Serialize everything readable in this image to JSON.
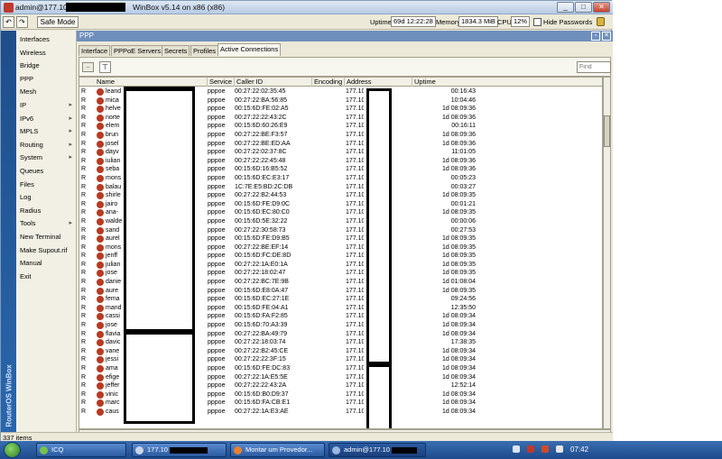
{
  "window": {
    "title_prefix": "admin@177.10",
    "title_suffix": "WinBox v5.14 on x86 (x86)",
    "min_label": "_",
    "max_label": "□",
    "close_label": "✕"
  },
  "toolbar": {
    "undo_label": "↶",
    "redo_label": "↷",
    "safe_mode_label": "Safe Mode",
    "uptime_label": "Uptime",
    "uptime_value": "69d 12:22:28",
    "memory_label": "Memory",
    "memory_value": "1834.3 MiB",
    "cpu_label": "CPU",
    "cpu_value": "12%",
    "hide_passwords_label": "Hide Passwords"
  },
  "sidebar": {
    "brand": "RouterOS WinBox",
    "items": [
      {
        "label": "Interfaces",
        "arrow": ""
      },
      {
        "label": "Wireless",
        "arrow": ""
      },
      {
        "label": "Bridge",
        "arrow": ""
      },
      {
        "label": "PPP",
        "arrow": ""
      },
      {
        "label": "Mesh",
        "arrow": ""
      },
      {
        "label": "IP",
        "arrow": "▸"
      },
      {
        "label": "IPv6",
        "arrow": "▸"
      },
      {
        "label": "MPLS",
        "arrow": "▸"
      },
      {
        "label": "Routing",
        "arrow": "▸"
      },
      {
        "label": "System",
        "arrow": "▸"
      },
      {
        "label": "Queues",
        "arrow": ""
      },
      {
        "label": "Files",
        "arrow": ""
      },
      {
        "label": "Log",
        "arrow": ""
      },
      {
        "label": "Radius",
        "arrow": ""
      },
      {
        "label": "Tools",
        "arrow": "▸"
      },
      {
        "label": "New Terminal",
        "arrow": ""
      },
      {
        "label": "Make Supout.rif",
        "arrow": ""
      },
      {
        "label": "Manual",
        "arrow": ""
      },
      {
        "label": "Exit",
        "arrow": ""
      }
    ]
  },
  "ppp": {
    "title": "PPP",
    "tabs": [
      "Interface",
      "PPPoE Servers",
      "Secrets",
      "Profiles",
      "Active Connections"
    ],
    "active_tab": "Active Connections",
    "minus_label": "−",
    "filter_label": "⊤",
    "find_placeholder": "Find",
    "columns": [
      "Name",
      "Service",
      "Caller ID",
      "Encoding",
      "Address",
      "Uptime"
    ],
    "status": "337 items",
    "rows": [
      {
        "flag": "R",
        "name": "leand",
        "service": "pppoe",
        "caller": "00:27:22:02:35:45",
        "addr": "177.10",
        "uptime": "00:16:43"
      },
      {
        "flag": "R",
        "name": "mica",
        "service": "pppoe",
        "caller": "00:27:22:BA:56:85",
        "addr": "177.10",
        "uptime": "10:04:46"
      },
      {
        "flag": "R",
        "name": "helve",
        "service": "pppoe",
        "caller": "00:15:6D:FE:02:A5",
        "addr": "177.10",
        "uptime": "1d 08:09:36"
      },
      {
        "flag": "R",
        "name": "norte",
        "service": "pppoe",
        "caller": "00:27:22:22:43:2C",
        "addr": "177.10",
        "uptime": "1d 08:09:36"
      },
      {
        "flag": "R",
        "name": "elem",
        "service": "pppoe",
        "caller": "00:15:6D:60:26:E9",
        "addr": "177.10",
        "uptime": "00:16:11"
      },
      {
        "flag": "R",
        "name": "brun",
        "service": "pppoe",
        "caller": "00:27:22:BE:F3:57",
        "addr": "177.10",
        "uptime": "1d 08:09:36"
      },
      {
        "flag": "R",
        "name": "josel",
        "service": "pppoe",
        "caller": "00:27:22:BE:ED:AA",
        "addr": "177.10",
        "uptime": "1d 08:09:36"
      },
      {
        "flag": "R",
        "name": "dayv",
        "service": "pppoe",
        "caller": "00:27:22:02:37:8C",
        "addr": "177.10",
        "uptime": "11:01:05"
      },
      {
        "flag": "R",
        "name": "iulian",
        "service": "pppoe",
        "caller": "00:27:22:22:45:48",
        "addr": "177.10",
        "uptime": "1d 08:09:36"
      },
      {
        "flag": "R",
        "name": "seba",
        "service": "pppoe",
        "caller": "00:15:6D:16:B5:52",
        "addr": "177.10",
        "uptime": "1d 08:09:36"
      },
      {
        "flag": "R",
        "name": "mons",
        "service": "pppoe",
        "caller": "00:15:6D:EC:E3:17",
        "addr": "177.10",
        "uptime": "00:05:23"
      },
      {
        "flag": "R",
        "name": "balau",
        "service": "pppoe",
        "caller": "1C:7E:E5:BD:2C:DB",
        "addr": "177.10",
        "uptime": "00:03:27"
      },
      {
        "flag": "R",
        "name": "shirle",
        "service": "pppoe",
        "caller": "00:27:22:B2:44:53",
        "addr": "177.10",
        "uptime": "1d 08:09:35"
      },
      {
        "flag": "R",
        "name": "jairo",
        "service": "pppoe",
        "caller": "00:15:6D:FE:D9:0C",
        "addr": "177.10",
        "uptime": "00:01:21"
      },
      {
        "flag": "R",
        "name": "ana-",
        "service": "pppoe",
        "caller": "00:15:6D:EC:80:C0",
        "addr": "177.10",
        "uptime": "1d 08:09:35"
      },
      {
        "flag": "R",
        "name": "walde",
        "service": "pppoe",
        "caller": "00:15:6D:5E:32:22",
        "addr": "177.10",
        "uptime": "00:00:06"
      },
      {
        "flag": "R",
        "name": "sand",
        "service": "pppoe",
        "caller": "00:27:22:30:58:73",
        "addr": "177.10",
        "uptime": "00:27:53"
      },
      {
        "flag": "R",
        "name": "aurel",
        "service": "pppoe",
        "caller": "00:15:6D:FE:D9:B5",
        "addr": "177.10",
        "uptime": "1d 08:09:35"
      },
      {
        "flag": "R",
        "name": "mons",
        "service": "pppoe",
        "caller": "00:27:22:BE:EF:14",
        "addr": "177.10",
        "uptime": "1d 08:09:35"
      },
      {
        "flag": "R",
        "name": "jenff",
        "service": "pppoe",
        "caller": "00:15:6D:FC:DE:8D",
        "addr": "177.10",
        "uptime": "1d 08:09:35"
      },
      {
        "flag": "R",
        "name": "julian",
        "service": "pppoe",
        "caller": "00:27:22:1A:E0:1A",
        "addr": "177.10",
        "uptime": "1d 08:09:35"
      },
      {
        "flag": "R",
        "name": "jose",
        "service": "pppoe",
        "caller": "00:27:22:18:02:47",
        "addr": "177.10",
        "uptime": "1d 08:09:35"
      },
      {
        "flag": "R",
        "name": "danie",
        "service": "pppoe",
        "caller": "00:27:22:BC:7E:9B",
        "addr": "177.10",
        "uptime": "1d 01:08:04"
      },
      {
        "flag": "R",
        "name": "aure",
        "service": "pppoe",
        "caller": "00:15:6D:E8:0A:47",
        "addr": "177.10",
        "uptime": "1d 08:09:35"
      },
      {
        "flag": "R",
        "name": "fema",
        "service": "pppoe",
        "caller": "00:15:6D:EC:27:1E",
        "addr": "177.10",
        "uptime": "09:24:56"
      },
      {
        "flag": "R",
        "name": "mand",
        "service": "pppoe",
        "caller": "00:15:6D:FE:04:A1",
        "addr": "177.10",
        "uptime": "12:35:50"
      },
      {
        "flag": "R",
        "name": "cassi",
        "service": "pppoe",
        "caller": "00:15:6D:FA:F2:85",
        "addr": "177.10",
        "uptime": "1d 08:09:34"
      },
      {
        "flag": "R",
        "name": "jose",
        "service": "pppoe",
        "caller": "00:15:6D:70:A3:39",
        "addr": "177.10",
        "uptime": "1d 08:09:34"
      },
      {
        "flag": "R",
        "name": "flavia",
        "service": "pppoe",
        "caller": "00:27:22:BA:49:79",
        "addr": "177.10",
        "uptime": "1d 08:09:34"
      },
      {
        "flag": "R",
        "name": "davic",
        "service": "pppoe",
        "caller": "00:27:22:18:03:74",
        "addr": "177.10",
        "uptime": "17:38:35"
      },
      {
        "flag": "R",
        "name": "vane",
        "service": "pppoe",
        "caller": "00:27:22:B2:45:CE",
        "addr": "177.10",
        "uptime": "1d 08:09:34"
      },
      {
        "flag": "R",
        "name": "jessi",
        "service": "pppoe",
        "caller": "00:27:22:22:3F:15",
        "addr": "177.10",
        "uptime": "1d 08:09:34"
      },
      {
        "flag": "R",
        "name": "ama",
        "service": "pppoe",
        "caller": "00:15:6D:FE:DC:83",
        "addr": "177.10",
        "uptime": "1d 08:09:34"
      },
      {
        "flag": "R",
        "name": "efige",
        "service": "pppoe",
        "caller": "00:27:22:1A:E5:5E",
        "addr": "177.10",
        "uptime": "1d 08:09:34"
      },
      {
        "flag": "R",
        "name": "jeffer",
        "service": "pppoe",
        "caller": "00:27:22:22:43:2A",
        "addr": "177.10",
        "uptime": "12:52:14"
      },
      {
        "flag": "R",
        "name": "vinic",
        "service": "pppoe",
        "caller": "00:15:6D:B0:D9:37",
        "addr": "177.10",
        "uptime": "1d 08:09:34"
      },
      {
        "flag": "R",
        "name": "marc",
        "service": "pppoe",
        "caller": "00:15:6D:FA:CB:E1",
        "addr": "177.10",
        "uptime": "1d 08:09:34"
      },
      {
        "flag": "R",
        "name": "caus",
        "service": "pppoe",
        "caller": "00:27:22:1A:E3:AE",
        "addr": "177.10",
        "uptime": "1d 08:09:34"
      }
    ]
  },
  "taskbar": {
    "tasks": [
      "ICQ",
      "177.10",
      "Montar um Provedor...",
      "admin@177.10"
    ],
    "clock": "07:42"
  },
  "colors": {
    "accent": "#6f8fbd",
    "taskbar": "#2a5aa0",
    "brand": "#1f4d8a",
    "row_icon": "#b83a22"
  }
}
